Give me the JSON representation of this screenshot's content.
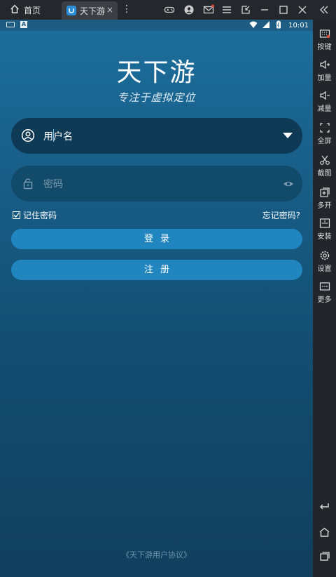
{
  "emulator": {
    "home_tab": "首页",
    "app_tab": "天下游",
    "tab_close": "×",
    "kebab": "⋮"
  },
  "statusbar": {
    "time": "10:01"
  },
  "app": {
    "title": "天下游",
    "slogan": "专注于虚拟定位",
    "username_placeholder": "用户名",
    "password_placeholder": "密码",
    "remember_label": "记住密码",
    "forgot_label": "忘记密码?",
    "login_button": "登录",
    "register_button": "注册",
    "agreement": "《天下游用户协议》"
  },
  "sidebar": {
    "items": [
      {
        "label": "按键",
        "icon": "keyboard-icon"
      },
      {
        "label": "加量",
        "icon": "volume-up-icon"
      },
      {
        "label": "减量",
        "icon": "volume-down-icon"
      },
      {
        "label": "全屏",
        "icon": "fullscreen-icon"
      },
      {
        "label": "截图",
        "icon": "scissors-icon"
      },
      {
        "label": "多开",
        "icon": "multi-open-icon"
      },
      {
        "label": "安装",
        "icon": "apk-install-icon"
      },
      {
        "label": "设置",
        "icon": "gear-icon"
      },
      {
        "label": "更多",
        "icon": "more-icon"
      }
    ]
  },
  "colors": {
    "accent": "#2186c0",
    "screen_top": "#1c6d9b",
    "screen_bottom": "#113f5d",
    "field_bg": "#0f3a55"
  }
}
